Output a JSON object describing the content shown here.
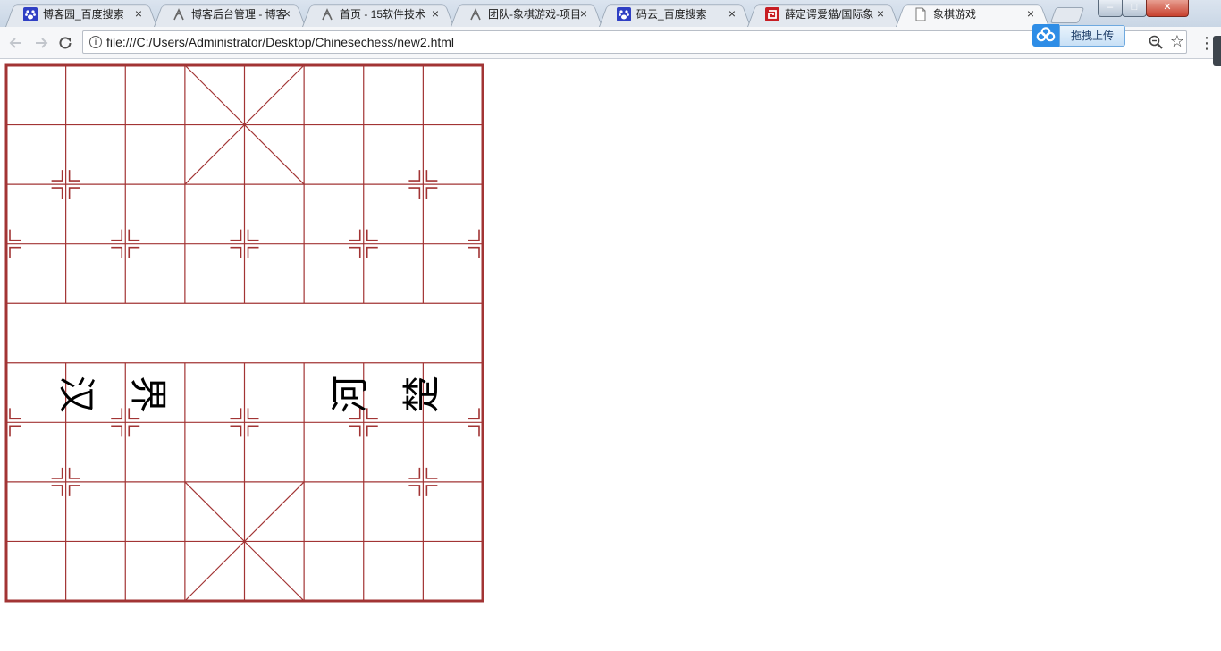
{
  "browser": {
    "tabs": [
      {
        "title": "博客园_百度搜索",
        "icon": "baidu-paw-icon",
        "active": false
      },
      {
        "title": "博客后台管理 - 博客",
        "icon": "cnblogs-icon",
        "active": false
      },
      {
        "title": "首页 - 15软件技术",
        "icon": "cnblogs-icon",
        "active": false
      },
      {
        "title": "团队-象棋游戏-项目",
        "icon": "cnblogs-icon",
        "active": false
      },
      {
        "title": "码云_百度搜索",
        "icon": "baidu-paw-icon",
        "active": false
      },
      {
        "title": "薛定谔爱猫/国际象",
        "icon": "gitee-icon",
        "active": false
      },
      {
        "title": "象棋游戏",
        "icon": "page-icon",
        "active": true
      }
    ],
    "close_glyph": "×",
    "url": "file:///C:/Users/Administrator/Desktop/Chinesechess/new2.html",
    "window_buttons": {
      "minimize": "–",
      "maximize": "□",
      "close": "✕"
    }
  },
  "upload_widget": {
    "label": "拖拽上传"
  },
  "board": {
    "files": 9,
    "ranks": 10,
    "line_color": "#a23434",
    "river_text": {
      "left": [
        "汉",
        "界"
      ],
      "right": [
        "河",
        "楚"
      ]
    }
  }
}
